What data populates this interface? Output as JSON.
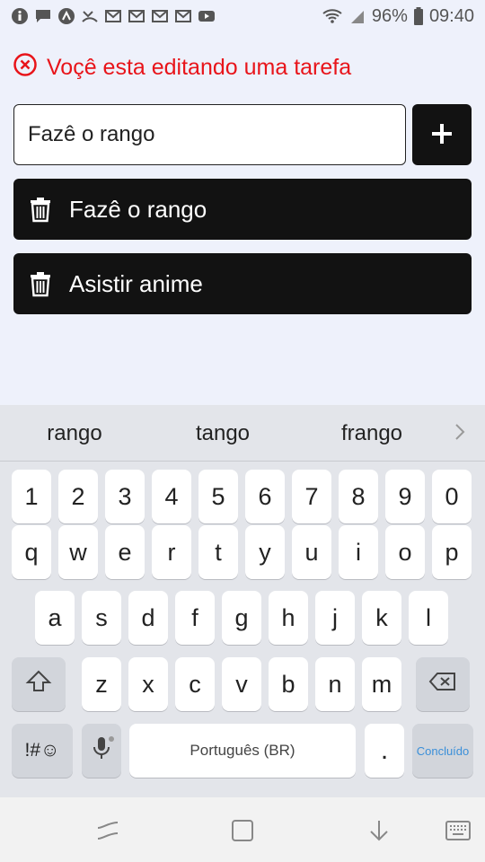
{
  "status_bar": {
    "left_icons": [
      "info-icon",
      "chat-icon",
      "app-icon",
      "missed-call-icon",
      "gmail-icon",
      "gmail-icon",
      "gmail-icon",
      "gmail-icon",
      "youtube-icon"
    ],
    "battery": "96%",
    "time": "09:40"
  },
  "banner": {
    "text": "Voçê esta editando uma tarefa",
    "color": "#e8141a"
  },
  "input": {
    "value": "Fazê o rango"
  },
  "tasks": [
    {
      "label": "Fazê o rango"
    },
    {
      "label": "Asistir anime"
    }
  ],
  "keyboard": {
    "suggestions": [
      "rango",
      "tango",
      "frango"
    ],
    "number_row": [
      "1",
      "2",
      "3",
      "4",
      "5",
      "6",
      "7",
      "8",
      "9",
      "0"
    ],
    "row1": [
      "q",
      "w",
      "e",
      "r",
      "t",
      "y",
      "u",
      "i",
      "o",
      "p"
    ],
    "row2": [
      "a",
      "s",
      "d",
      "f",
      "g",
      "h",
      "j",
      "k",
      "l"
    ],
    "row3": [
      "z",
      "x",
      "c",
      "v",
      "b",
      "n",
      "m"
    ],
    "symbols_label": "!#☺",
    "space_label": "Português (BR)",
    "period_label": ".",
    "done_label": "Concluído"
  }
}
